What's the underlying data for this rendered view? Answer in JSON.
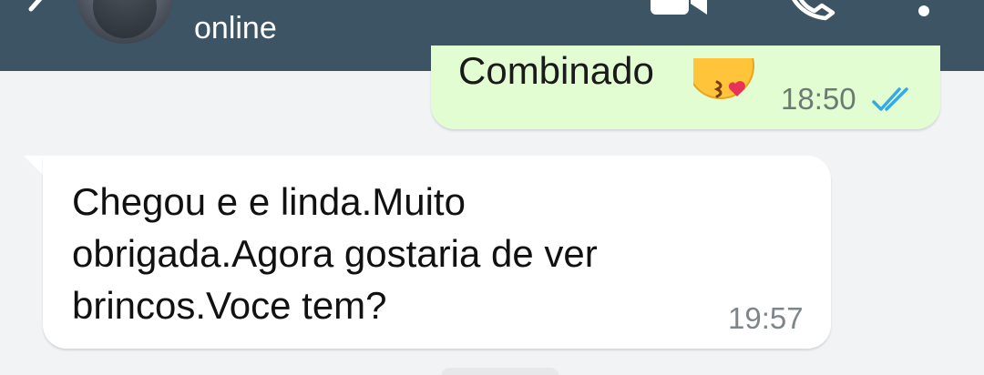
{
  "header": {
    "status": "online",
    "icons": [
      "back-arrow-icon",
      "avatar",
      "video-call-icon",
      "voice-call-icon",
      "more-options-icon"
    ],
    "background": "#3c5463"
  },
  "messages": [
    {
      "direction": "outgoing",
      "text": "Combinado",
      "emoji": "face-blowing-kiss",
      "time": "18:50",
      "status": "read",
      "bubble_color": "#e2fdd2"
    },
    {
      "direction": "incoming",
      "lines": [
        "Chegou e e linda.Muito",
        "obrigada.Agora gostaria de ver",
        "brincos.Voce tem?"
      ],
      "time": "19:57",
      "bubble_color": "#ffffff"
    }
  ],
  "colors": {
    "chat_background": "#f2f3f5",
    "read_ticks": "#34a9e8"
  }
}
